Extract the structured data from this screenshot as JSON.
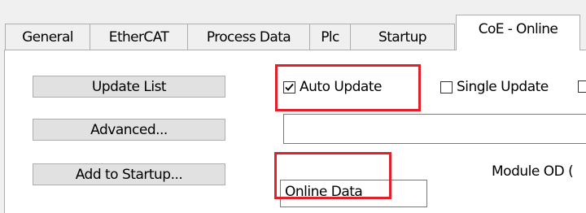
{
  "tabs": [
    {
      "label": "General"
    },
    {
      "label": "EtherCAT"
    },
    {
      "label": "Process Data"
    },
    {
      "label": "Plc"
    },
    {
      "label": "Startup"
    },
    {
      "label": "CoE - Online",
      "active": true
    }
  ],
  "buttons": {
    "update_list": "Update List",
    "advanced": "Advanced...",
    "add_to_startup": "Add to Startup..."
  },
  "checkboxes": {
    "auto_update": {
      "label": "Auto Update",
      "checked": true
    },
    "single_update": {
      "label": "Single Update",
      "checked": false
    }
  },
  "fields": {
    "online_data": {
      "value": "Online Data"
    },
    "blank_field": {
      "value": ""
    }
  },
  "labels": {
    "module_od": "Module OD ("
  },
  "colors": {
    "highlight": "#e0202a",
    "window_bg": "#f0f0f0",
    "button_bg": "#e1e1e1"
  }
}
